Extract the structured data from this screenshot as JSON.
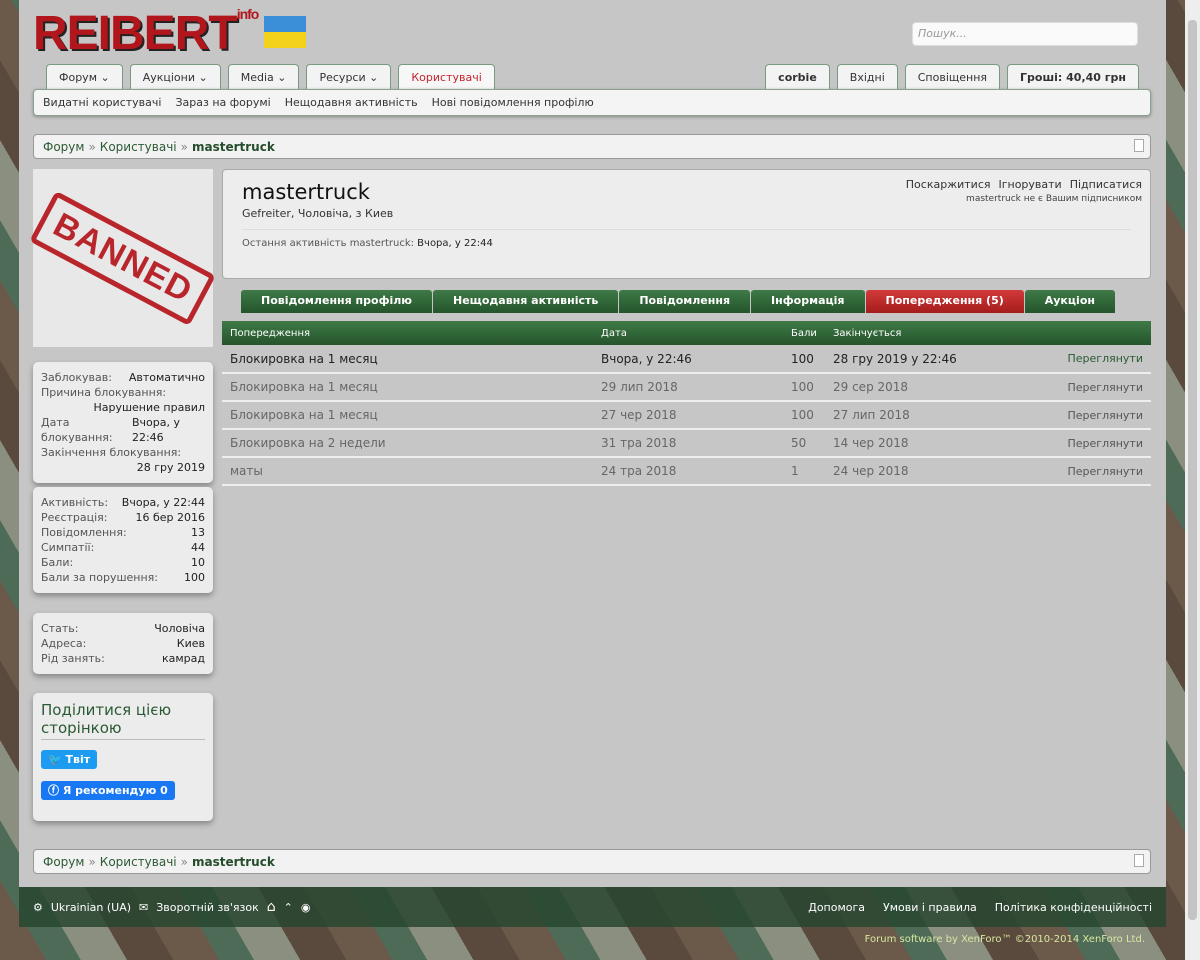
{
  "header": {
    "logo": "REIBERT",
    "logo_suffix": "info",
    "search_placeholder": "Пошук..."
  },
  "nav": {
    "tabs": [
      {
        "label": "Форум ⌄"
      },
      {
        "label": "Аукціони ⌄"
      },
      {
        "label": "Media ⌄"
      },
      {
        "label": "Ресурси ⌄"
      },
      {
        "label": "Користувачі"
      }
    ],
    "right": [
      {
        "label": "corbie"
      },
      {
        "label": "Вхідні"
      },
      {
        "label": "Сповіщення"
      },
      {
        "label": "Гроші: 40,40 грн"
      }
    ],
    "sub": [
      "Видатні користувачі",
      "Зараз на форумі",
      "Нещодавня активність",
      "Нові повідомлення профілю"
    ]
  },
  "breadcrumb": [
    "Форум",
    "Користувачі",
    "mastertruck"
  ],
  "avatar": {
    "stamp": "BANNED"
  },
  "ban": {
    "by_label": "Заблокував:",
    "by": "Автоматично",
    "reason_label": "Причина блокування:",
    "reason": "Нарушение правил",
    "date_label": "Дата блокування:",
    "date": "Вчора, у 22:46",
    "end_label": "Закінчення блокування:",
    "end": "28 гру 2019"
  },
  "stats": [
    {
      "k": "Активність:",
      "v": "Вчора, у 22:44"
    },
    {
      "k": "Реєстрація:",
      "v": "16 бер 2016"
    },
    {
      "k": "Повідомлення:",
      "v": "13"
    },
    {
      "k": "Симпатії:",
      "v": "44"
    },
    {
      "k": "Бали:",
      "v": "10"
    },
    {
      "k": "Бали за порушення:",
      "v": "100"
    }
  ],
  "info": [
    {
      "k": "Стать:",
      "v": "Чоловіча"
    },
    {
      "k": "Адреса:",
      "v": "Киев"
    },
    {
      "k": "Рід занять:",
      "v": "камрад"
    }
  ],
  "share": {
    "title": "Поділитися цією сторінкою",
    "tweet": "Твіт",
    "fb": "Я рекомендую 0"
  },
  "profile": {
    "name": "mastertruck",
    "subtitle": "Gefreiter, Чоловіча, з Киев",
    "last_label": "Остання активність mastertruck:",
    "last": "Вчора, у 22:44",
    "report": "Поскаржитися",
    "ignore": "Ігнорувати",
    "follow": "Підписатися",
    "follow_note": "mastertruck не є Вашим підписником"
  },
  "tabs": [
    "Повідомлення профілю",
    "Нещодавня активність",
    "Повідомлення",
    "Інформація",
    "Попередження (5)",
    "Аукціон"
  ],
  "table": {
    "headers": [
      "Попередження",
      "Дата",
      "Бали",
      "Закінчується",
      ""
    ],
    "rows": [
      [
        "Блокировка на 1 месяц",
        "Вчора, у 22:46",
        "100",
        "28 гру 2019 у 22:46",
        "Переглянути"
      ],
      [
        "Блокировка на 1 месяц",
        "29 лип 2018",
        "100",
        "29 сер 2018",
        "Переглянути"
      ],
      [
        "Блокировка на 1 месяц",
        "27 чер 2018",
        "100",
        "27 лип 2018",
        "Переглянути"
      ],
      [
        "Блокировка на 2 недели",
        "31 тра 2018",
        "50",
        "14 чер 2018",
        "Переглянути"
      ],
      [
        "маты",
        "24 тра 2018",
        "1",
        "24 чер 2018",
        "Переглянути"
      ]
    ]
  },
  "footer": {
    "lang": "Ukrainian (UA)",
    "contact": "Зворотній зв'язок",
    "help": "Допомога",
    "terms": "Умови і правила",
    "privacy": "Політика конфіденційності",
    "copyright": "Forum software by XenForo™ ©2010-2014 XenForo Ltd."
  }
}
